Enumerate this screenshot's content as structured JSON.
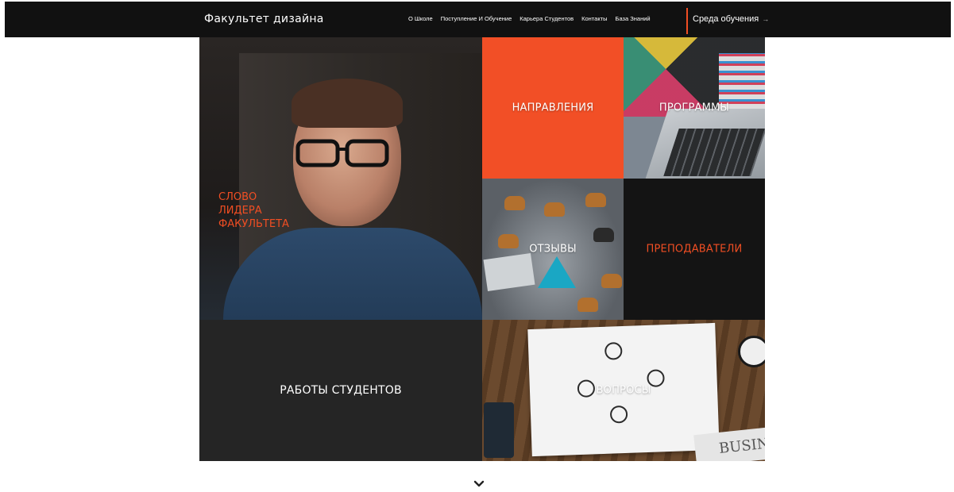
{
  "header": {
    "logo": "Факультет дизайна",
    "nav": [
      {
        "label": "О Школе"
      },
      {
        "label": "Поступление И Обучение"
      },
      {
        "label": "Карьера Студентов"
      },
      {
        "label": "Контакты"
      },
      {
        "label": "База Знаний"
      }
    ],
    "environment_link": "Среда обучения",
    "environment_arrow": "→"
  },
  "tiles": {
    "leader": {
      "lines": [
        "СЛОВО",
        "ЛИДЕРА",
        "ФАКУЛЬТЕТА"
      ]
    },
    "directions": {
      "label": "НАПРАВЛЕНИЯ"
    },
    "programs": {
      "label": "ПРОГРАММЫ"
    },
    "reviews": {
      "label": "ОТЗЫВЫ"
    },
    "teachers": {
      "label": "ПРЕПОДАВАТЕЛИ"
    },
    "works": {
      "label": "РАБОТЫ СТУДЕНТОВ"
    },
    "questions": {
      "label": "ВОПРОСЫ",
      "newspaper_text": "BUSINE"
    }
  },
  "colors": {
    "accent": "#f04e23",
    "navbar": "#111111",
    "tile_dark": "#252525",
    "tile_black": "#141414"
  },
  "icons": {
    "scroll_down": "chevron-down-icon"
  }
}
